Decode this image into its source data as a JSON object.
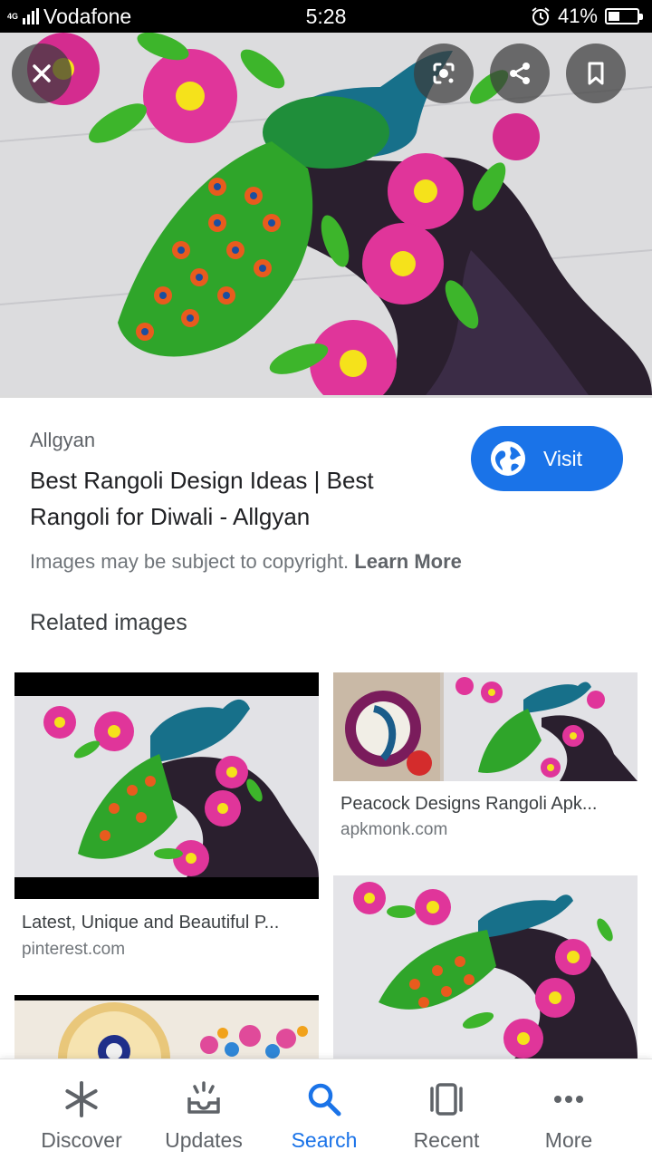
{
  "status_bar": {
    "network": "4G",
    "carrier": "Vodafone",
    "time": "5:28",
    "battery_percent": "41%",
    "battery_level": 0.41,
    "alarm_icon": "alarm-clock-icon"
  },
  "hero": {
    "buttons": {
      "close_icon": "close-icon",
      "lens_icon": "google-lens-icon",
      "share_icon": "share-icon",
      "bookmark_icon": "bookmark-icon"
    }
  },
  "result": {
    "source": "Allgyan",
    "title": "Best Rangoli Design Ideas | Best Rangoli for Diwali - Allgyan",
    "visit_label": "Visit",
    "copyright_text": "Images may be subject to copyright.",
    "learn_more": "Learn More"
  },
  "related": {
    "heading": "Related images",
    "items": [
      {
        "title": "Latest, Unique and Beautiful P...",
        "domain": "pinterest.com"
      },
      {
        "title": "Peacock Designs Rangoli Apk...",
        "domain": "apkmonk.com"
      },
      {
        "title": "",
        "domain": ""
      },
      {
        "title": "",
        "domain": ""
      }
    ]
  },
  "bottom_nav": {
    "items": [
      {
        "label": "Discover",
        "icon": "discover-asterisk-icon"
      },
      {
        "label": "Updates",
        "icon": "updates-tray-icon"
      },
      {
        "label": "Search",
        "icon": "search-icon"
      },
      {
        "label": "Recent",
        "icon": "recent-cards-icon"
      },
      {
        "label": "More",
        "icon": "more-dots-icon"
      }
    ],
    "active": "Search"
  },
  "colors": {
    "accent": "#1a73e8",
    "text_primary": "#202124",
    "text_secondary": "#5f6368",
    "rangoli_pink": "#e0359a",
    "rangoli_green": "#3db52b",
    "rangoli_teal": "#1d7a8c"
  }
}
